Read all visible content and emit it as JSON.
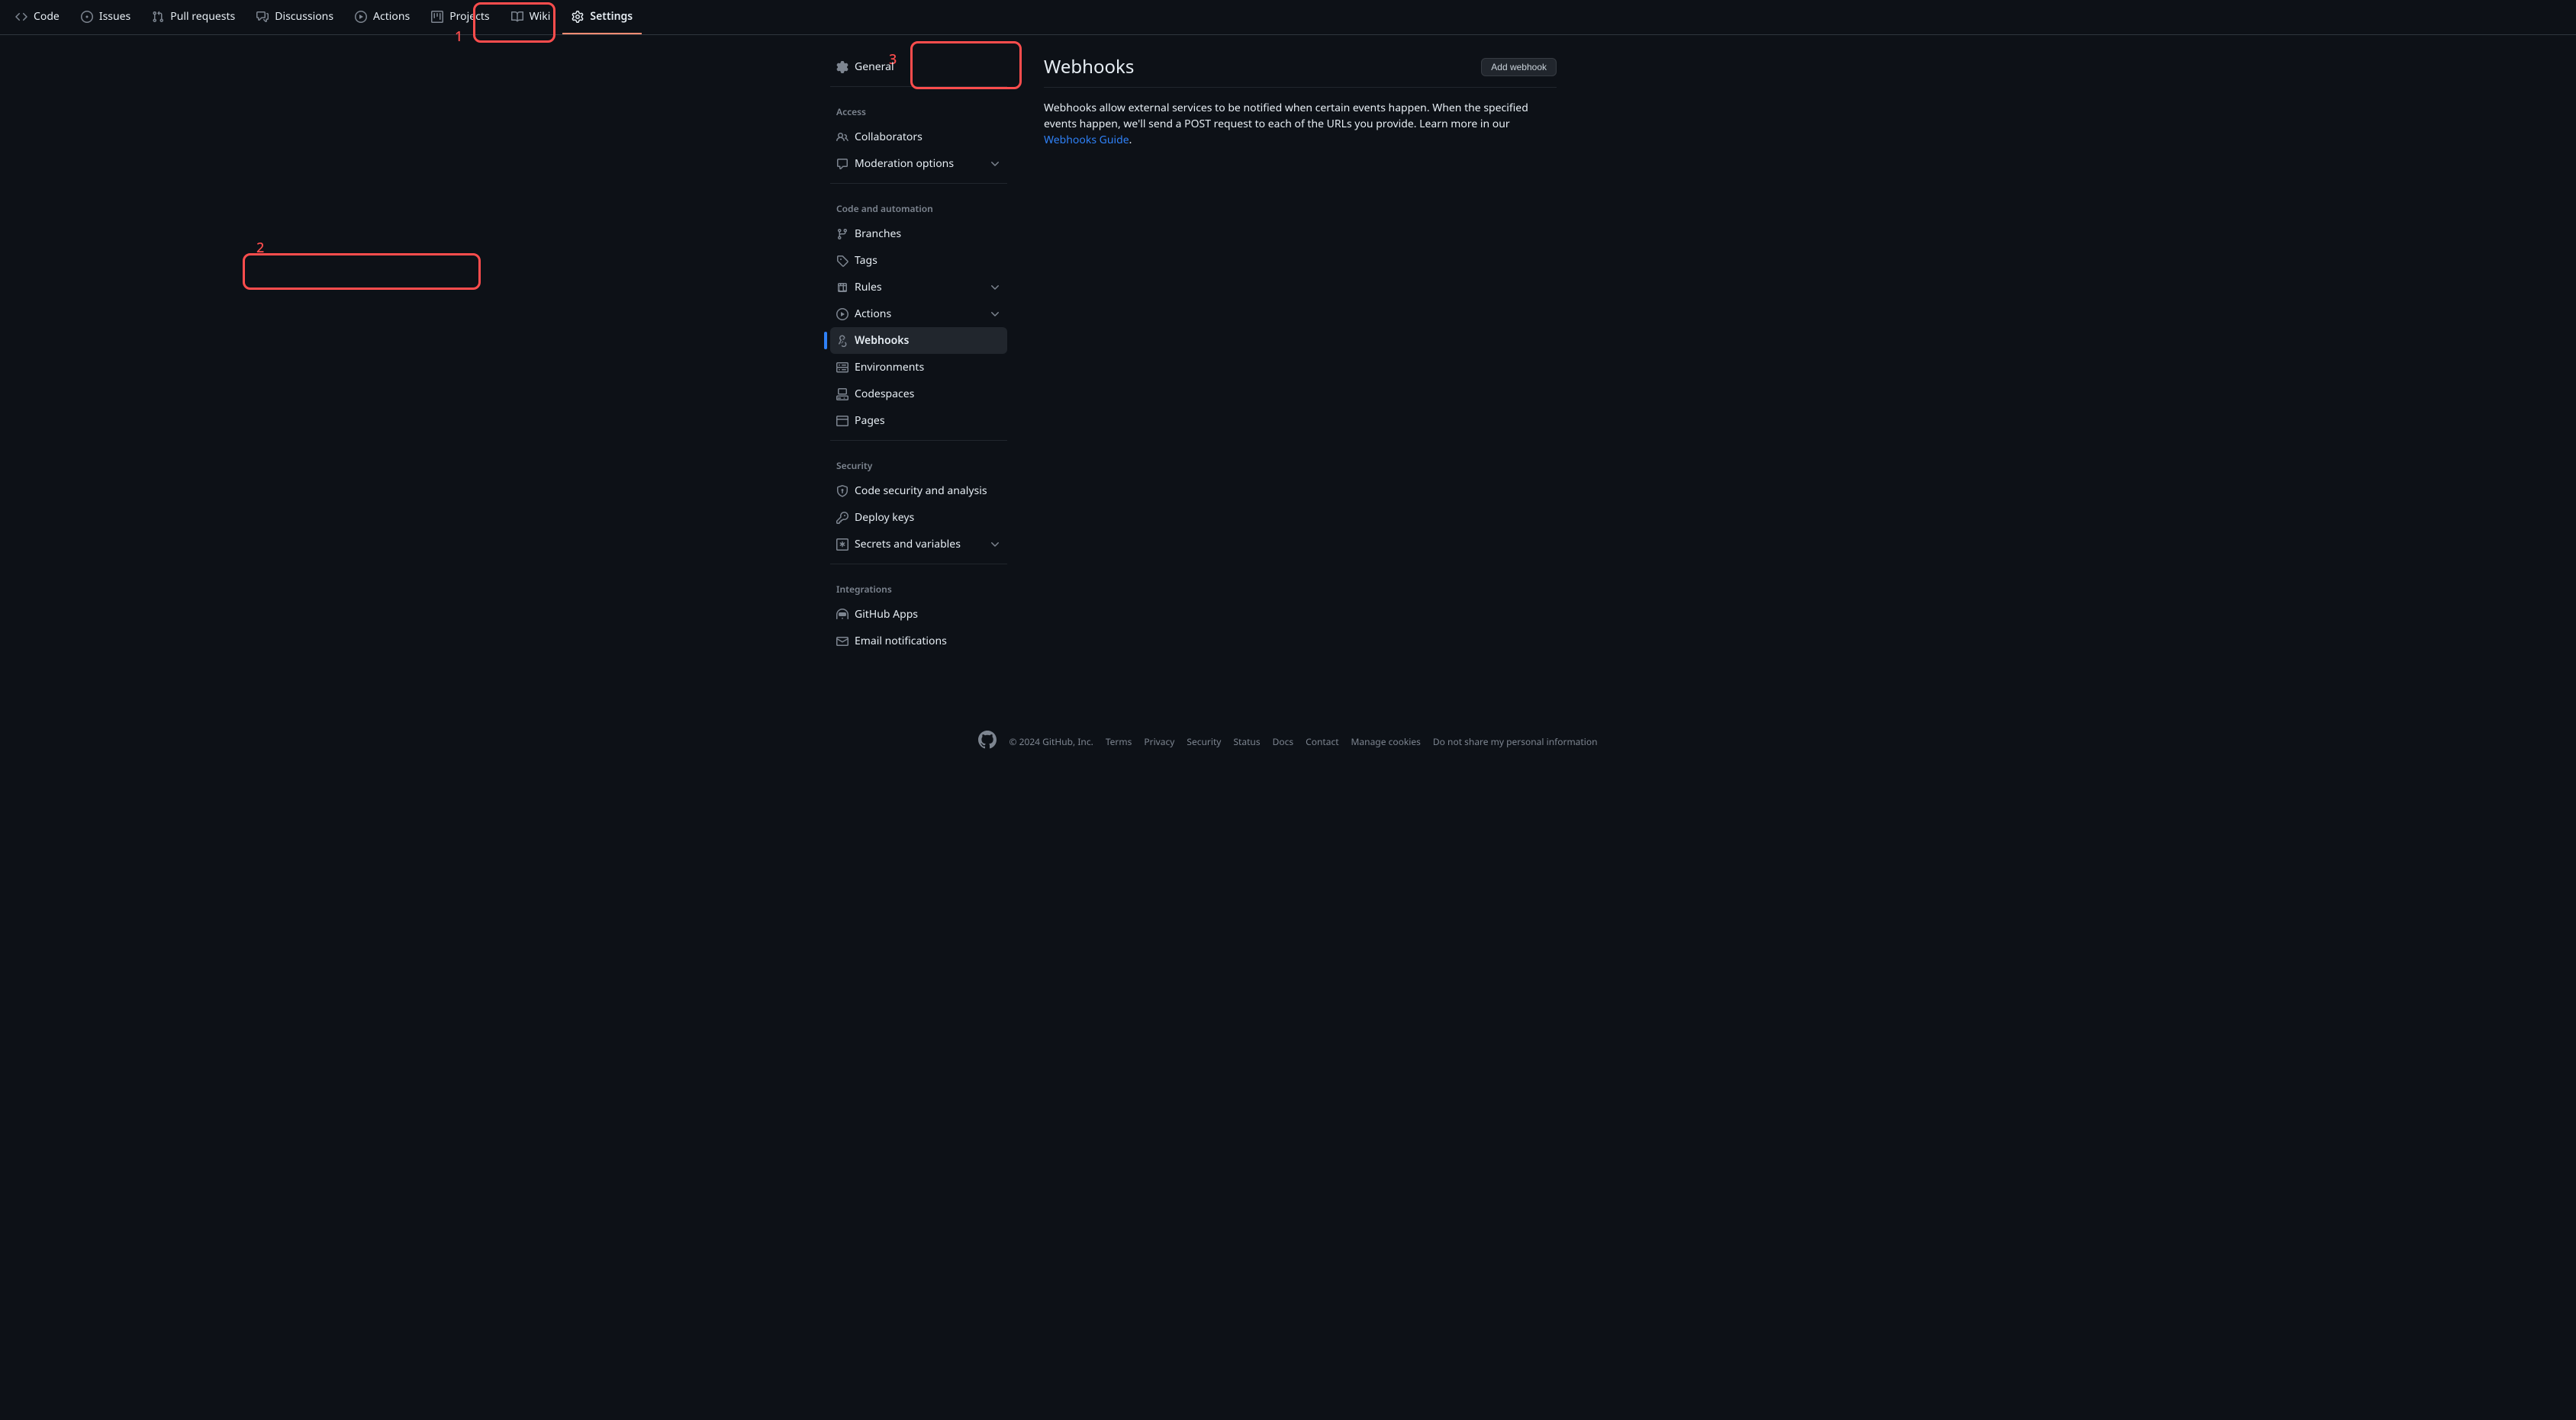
{
  "topnav": {
    "code": "Code",
    "issues": "Issues",
    "pulls": "Pull requests",
    "discussions": "Discussions",
    "actions": "Actions",
    "projects": "Projects",
    "wiki": "Wiki",
    "settings": "Settings"
  },
  "annotations": {
    "n1": "1",
    "n2": "2",
    "n3": "3"
  },
  "sidebar": {
    "general": "General",
    "access_title": "Access",
    "collaborators": "Collaborators",
    "moderation": "Moderation options",
    "code_automation_title": "Code and automation",
    "branches": "Branches",
    "tags": "Tags",
    "rules": "Rules",
    "actions": "Actions",
    "webhooks": "Webhooks",
    "environments": "Environments",
    "codespaces": "Codespaces",
    "pages": "Pages",
    "security_title": "Security",
    "code_security": "Code security and analysis",
    "deploy_keys": "Deploy keys",
    "secrets": "Secrets and variables",
    "integrations_title": "Integrations",
    "github_apps": "GitHub Apps",
    "email_notifications": "Email notifications"
  },
  "content": {
    "title": "Webhooks",
    "add_button": "Add webhook",
    "body_text": "Webhooks allow external services to be notified when certain events happen. When the specified events happen, we'll send a POST request to each of the URLs you provide. Learn more in our ",
    "guide_link": "Webhooks Guide",
    "period": "."
  },
  "footer": {
    "copyright": "© 2024 GitHub, Inc.",
    "terms": "Terms",
    "privacy": "Privacy",
    "security": "Security",
    "status": "Status",
    "docs": "Docs",
    "contact": "Contact",
    "manage_cookies": "Manage cookies",
    "do_not_share": "Do not share my personal information"
  }
}
